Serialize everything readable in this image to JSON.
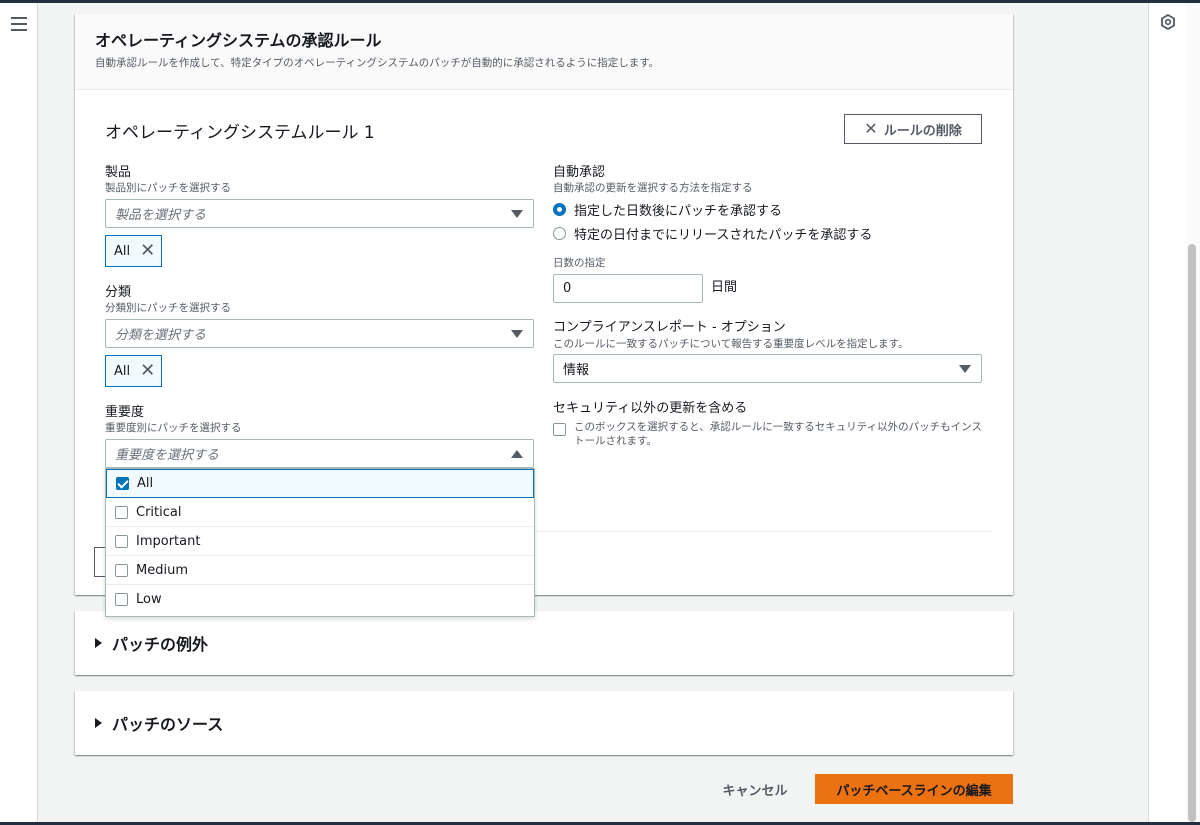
{
  "page": {
    "section_title": "オペレーティングシステムの承認ルール",
    "section_desc": "自動承認ルールを作成して、特定タイプのオペレーティングシステムのパッチが自動的に承認されるように指定します。"
  },
  "rule": {
    "title": "オペレーティングシステムルール 1",
    "delete_label": "ルールの削除"
  },
  "product": {
    "label": "製品",
    "desc": "製品別にパッチを選択する",
    "placeholder": "製品を選択する",
    "token": "All"
  },
  "classification": {
    "label": "分類",
    "desc": "分類別にパッチを選択する",
    "placeholder": "分類を選択する",
    "token": "All"
  },
  "severity": {
    "label": "重要度",
    "desc": "重要度別にパッチを選択する",
    "placeholder": "重要度を選択する",
    "options": [
      {
        "label": "All",
        "checked": true
      },
      {
        "label": "Critical",
        "checked": false
      },
      {
        "label": "Important",
        "checked": false
      },
      {
        "label": "Medium",
        "checked": false
      },
      {
        "label": "Low",
        "checked": false
      }
    ]
  },
  "auto_approval": {
    "label": "自動承認",
    "desc": "自動承認の更新を選択する方法を指定する",
    "option1": "指定した日数後にパッチを承認する",
    "option2": "特定の日付までにリリースされたパッチを承認する",
    "selected": "option1",
    "days_label": "日数の指定",
    "days_value": "0",
    "days_unit": "日間"
  },
  "compliance": {
    "label": "コンプライアンスレポート - オプション",
    "desc": "このルールに一致するパッチについて報告する重要度レベルを指定します。",
    "value": "情報"
  },
  "nonsecurity": {
    "label": "セキュリティ以外の更新を含める",
    "checkbox_text": "このボックスを選択すると、承認ルールに一致するセキュリティ以外のパッチもインストールされます。",
    "checked": false
  },
  "sections": {
    "exceptions": "パッチの例外",
    "sources": "パッチのソース"
  },
  "footer": {
    "cancel": "キャンセル",
    "submit": "パッチベースラインの編集"
  },
  "colors": {
    "primary": "#ec7211",
    "accent": "#0073bb"
  }
}
